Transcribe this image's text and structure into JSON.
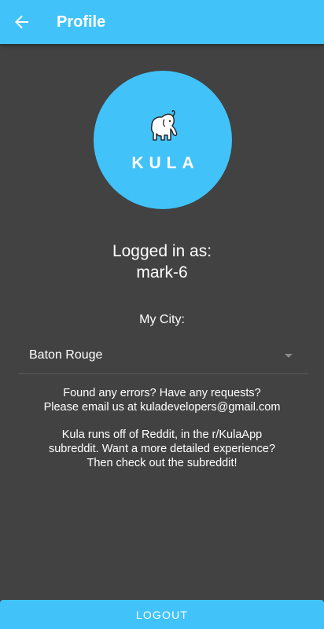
{
  "appbar": {
    "title": "Profile",
    "back_icon": "arrow-left-icon",
    "color": "#41c3f9"
  },
  "logo": {
    "text": "KULA",
    "icon": "elephant-icon",
    "color": "#41c3f9"
  },
  "account": {
    "label": "Logged in as:",
    "username": "mark-6"
  },
  "city": {
    "label": "My City:",
    "selected": "Baton Rouge",
    "dropdown_icon": "caret-down-icon"
  },
  "info": {
    "line1": "Found any errors? Have any requests?",
    "line2": "Please email us at kuladevelopers@gmail.com",
    "line3": "Kula runs off of Reddit, in the r/KulaApp",
    "line4": "subreddit. Want a more detailed experience?",
    "line5": "Then check out the subreddit!"
  },
  "logout": {
    "label": "LOGOUT"
  },
  "colors": {
    "background": "#424242",
    "accent": "#41c3f9"
  }
}
